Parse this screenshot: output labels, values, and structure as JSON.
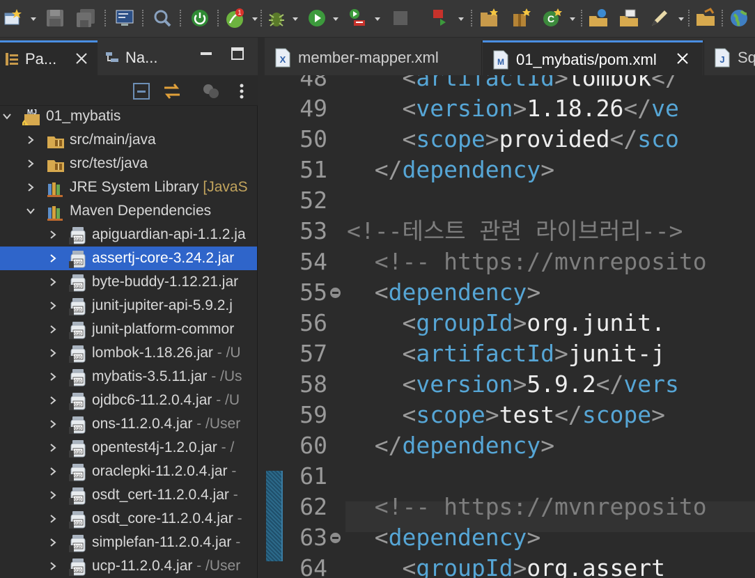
{
  "colors": {
    "accent": "#4a8fe2",
    "selection": "#2f65ca",
    "tag": "#56a6d6",
    "comment": "#7e7e7e",
    "decoration": "#c2a45d"
  },
  "toolbar": {
    "icons": [
      "new-wizard-icon",
      "save-icon",
      "save-all-icon",
      "terminal-icon",
      "search-icon",
      "power-icon",
      "spring-boot-icon",
      "debug-icon",
      "run-icon",
      "run-server-icon",
      "stop-icon",
      "external-tools-icon",
      "new-java-project-icon",
      "new-package-icon",
      "new-class-icon",
      "open-type-icon",
      "open-task-icon",
      "annotation-icon",
      "folder-icon",
      "globe-icon"
    ]
  },
  "left_panel": {
    "tabs": [
      {
        "label": "Pa..."
      },
      {
        "label": "Na..."
      }
    ]
  },
  "tree": [
    {
      "label": "01_mybatis",
      "level": 0,
      "expanded": true,
      "icon": "maven-project-icon"
    },
    {
      "label": "src/main/java",
      "level": 1,
      "expanded": false,
      "icon": "source-folder-icon"
    },
    {
      "label": "src/test/java",
      "level": 1,
      "expanded": false,
      "icon": "source-folder-icon"
    },
    {
      "label": "JRE System Library",
      "deco": " [JavaS",
      "level": 1,
      "expanded": false,
      "icon": "library-icon"
    },
    {
      "label": "Maven Dependencies",
      "level": 1,
      "expanded": true,
      "icon": "library-icon"
    },
    {
      "label": "apiguardian-api-1.1.2.ja",
      "level": 2,
      "icon": "jar-icon"
    },
    {
      "label": "assertj-core-3.24.2.jar",
      "level": 2,
      "icon": "jar-icon",
      "selected": true
    },
    {
      "label": "byte-buddy-1.12.21.jar",
      "level": 2,
      "icon": "jar-icon"
    },
    {
      "label": "junit-jupiter-api-5.9.2.j",
      "level": 2,
      "icon": "jar-icon"
    },
    {
      "label": "junit-platform-commor",
      "level": 2,
      "icon": "jar-icon"
    },
    {
      "label": "lombok-1.18.26.jar",
      "path": " - /U",
      "level": 2,
      "icon": "jar-icon"
    },
    {
      "label": "mybatis-3.5.11.jar",
      "path": " - /Us",
      "level": 2,
      "icon": "jar-icon"
    },
    {
      "label": "ojdbc6-11.2.0.4.jar",
      "path": " - /U",
      "level": 2,
      "icon": "jar-icon"
    },
    {
      "label": "ons-11.2.0.4.jar",
      "path": " - /User",
      "level": 2,
      "icon": "jar-icon"
    },
    {
      "label": "opentest4j-1.2.0.jar",
      "path": " - /",
      "level": 2,
      "icon": "jar-icon"
    },
    {
      "label": "oraclepki-11.2.0.4.jar",
      "path": " -",
      "level": 2,
      "icon": "jar-icon"
    },
    {
      "label": "osdt_cert-11.2.0.4.jar",
      "path": " -",
      "level": 2,
      "icon": "jar-icon"
    },
    {
      "label": "osdt_core-11.2.0.4.jar",
      "path": " -",
      "level": 2,
      "icon": "jar-icon"
    },
    {
      "label": "simplefan-11.2.0.4.jar",
      "path": " -",
      "level": 2,
      "icon": "jar-icon"
    },
    {
      "label": "ucp-11.2.0.4.jar",
      "path": " - /User",
      "level": 2,
      "icon": "jar-icon"
    }
  ],
  "editor": {
    "tabs": [
      {
        "label": "member-mapper.xml",
        "icon": "xml-file-icon",
        "active": false
      },
      {
        "label": "01_mybatis/pom.xml",
        "icon": "maven-pom-icon",
        "active": true
      },
      {
        "label": "Sq",
        "icon": "java-file-icon",
        "active": false
      }
    ],
    "current_line": "61",
    "lines": [
      {
        "num": "48",
        "indent": "    ",
        "segments": [
          {
            "t": "b",
            "v": "<"
          },
          {
            "t": "t",
            "v": "artifactId"
          },
          {
            "t": "b",
            "v": ">"
          },
          {
            "t": "x",
            "v": "lombok"
          },
          {
            "t": "b",
            "v": "</"
          }
        ]
      },
      {
        "num": "49",
        "indent": "    ",
        "segments": [
          {
            "t": "b",
            "v": "<"
          },
          {
            "t": "t",
            "v": "version"
          },
          {
            "t": "b",
            "v": ">"
          },
          {
            "t": "x",
            "v": "1.18.26"
          },
          {
            "t": "b",
            "v": "</"
          },
          {
            "t": "t",
            "v": "ve"
          }
        ]
      },
      {
        "num": "50",
        "indent": "    ",
        "segments": [
          {
            "t": "b",
            "v": "<"
          },
          {
            "t": "t",
            "v": "scope"
          },
          {
            "t": "b",
            "v": ">"
          },
          {
            "t": "x",
            "v": "provided"
          },
          {
            "t": "b",
            "v": "</"
          },
          {
            "t": "t",
            "v": "sco"
          }
        ]
      },
      {
        "num": "51",
        "indent": "  ",
        "segments": [
          {
            "t": "b",
            "v": "</"
          },
          {
            "t": "t",
            "v": "dependency"
          },
          {
            "t": "b",
            "v": ">"
          }
        ]
      },
      {
        "num": "52",
        "indent": "",
        "segments": []
      },
      {
        "num": "53",
        "indent": "",
        "segments": [
          {
            "t": "c",
            "v": "<!--테스트 관련 라이브러리-->"
          }
        ]
      },
      {
        "num": "54",
        "indent": "  ",
        "segments": [
          {
            "t": "c",
            "v": "<!-- https://mvnreposito"
          }
        ]
      },
      {
        "num": "55",
        "indent": "  ",
        "fold": true,
        "segments": [
          {
            "t": "b",
            "v": "<"
          },
          {
            "t": "t",
            "v": "dependency"
          },
          {
            "t": "b",
            "v": ">"
          }
        ]
      },
      {
        "num": "56",
        "indent": "    ",
        "segments": [
          {
            "t": "b",
            "v": "<"
          },
          {
            "t": "t",
            "v": "groupId"
          },
          {
            "t": "b",
            "v": ">"
          },
          {
            "t": "x",
            "v": "org.junit."
          }
        ]
      },
      {
        "num": "57",
        "indent": "    ",
        "segments": [
          {
            "t": "b",
            "v": "<"
          },
          {
            "t": "t",
            "v": "artifactId"
          },
          {
            "t": "b",
            "v": ">"
          },
          {
            "t": "x",
            "v": "junit-j"
          }
        ]
      },
      {
        "num": "58",
        "indent": "    ",
        "segments": [
          {
            "t": "b",
            "v": "<"
          },
          {
            "t": "t",
            "v": "version"
          },
          {
            "t": "b",
            "v": ">"
          },
          {
            "t": "x",
            "v": "5.9.2"
          },
          {
            "t": "b",
            "v": "</"
          },
          {
            "t": "t",
            "v": "vers"
          }
        ]
      },
      {
        "num": "59",
        "indent": "    ",
        "segments": [
          {
            "t": "b",
            "v": "<"
          },
          {
            "t": "t",
            "v": "scope"
          },
          {
            "t": "b",
            "v": ">"
          },
          {
            "t": "x",
            "v": "test"
          },
          {
            "t": "b",
            "v": "</"
          },
          {
            "t": "t",
            "v": "scope"
          },
          {
            "t": "b",
            "v": ">"
          }
        ]
      },
      {
        "num": "60",
        "indent": "  ",
        "segments": [
          {
            "t": "b",
            "v": "</"
          },
          {
            "t": "t",
            "v": "dependency"
          },
          {
            "t": "b",
            "v": ">"
          }
        ]
      },
      {
        "num": "61",
        "indent": "",
        "segments": []
      },
      {
        "num": "62",
        "indent": "  ",
        "segments": [
          {
            "t": "c",
            "v": "<!-- https://mvnreposito"
          }
        ]
      },
      {
        "num": "63",
        "indent": "  ",
        "fold": true,
        "segments": [
          {
            "t": "b",
            "v": "<"
          },
          {
            "t": "t",
            "v": "dependency"
          },
          {
            "t": "b",
            "v": ">"
          }
        ]
      },
      {
        "num": "64",
        "indent": "    ",
        "segments": [
          {
            "t": "b",
            "v": "<"
          },
          {
            "t": "t",
            "v": "groupId"
          },
          {
            "t": "b",
            "v": ">"
          },
          {
            "t": "x",
            "v": "org.assert"
          }
        ]
      }
    ]
  }
}
